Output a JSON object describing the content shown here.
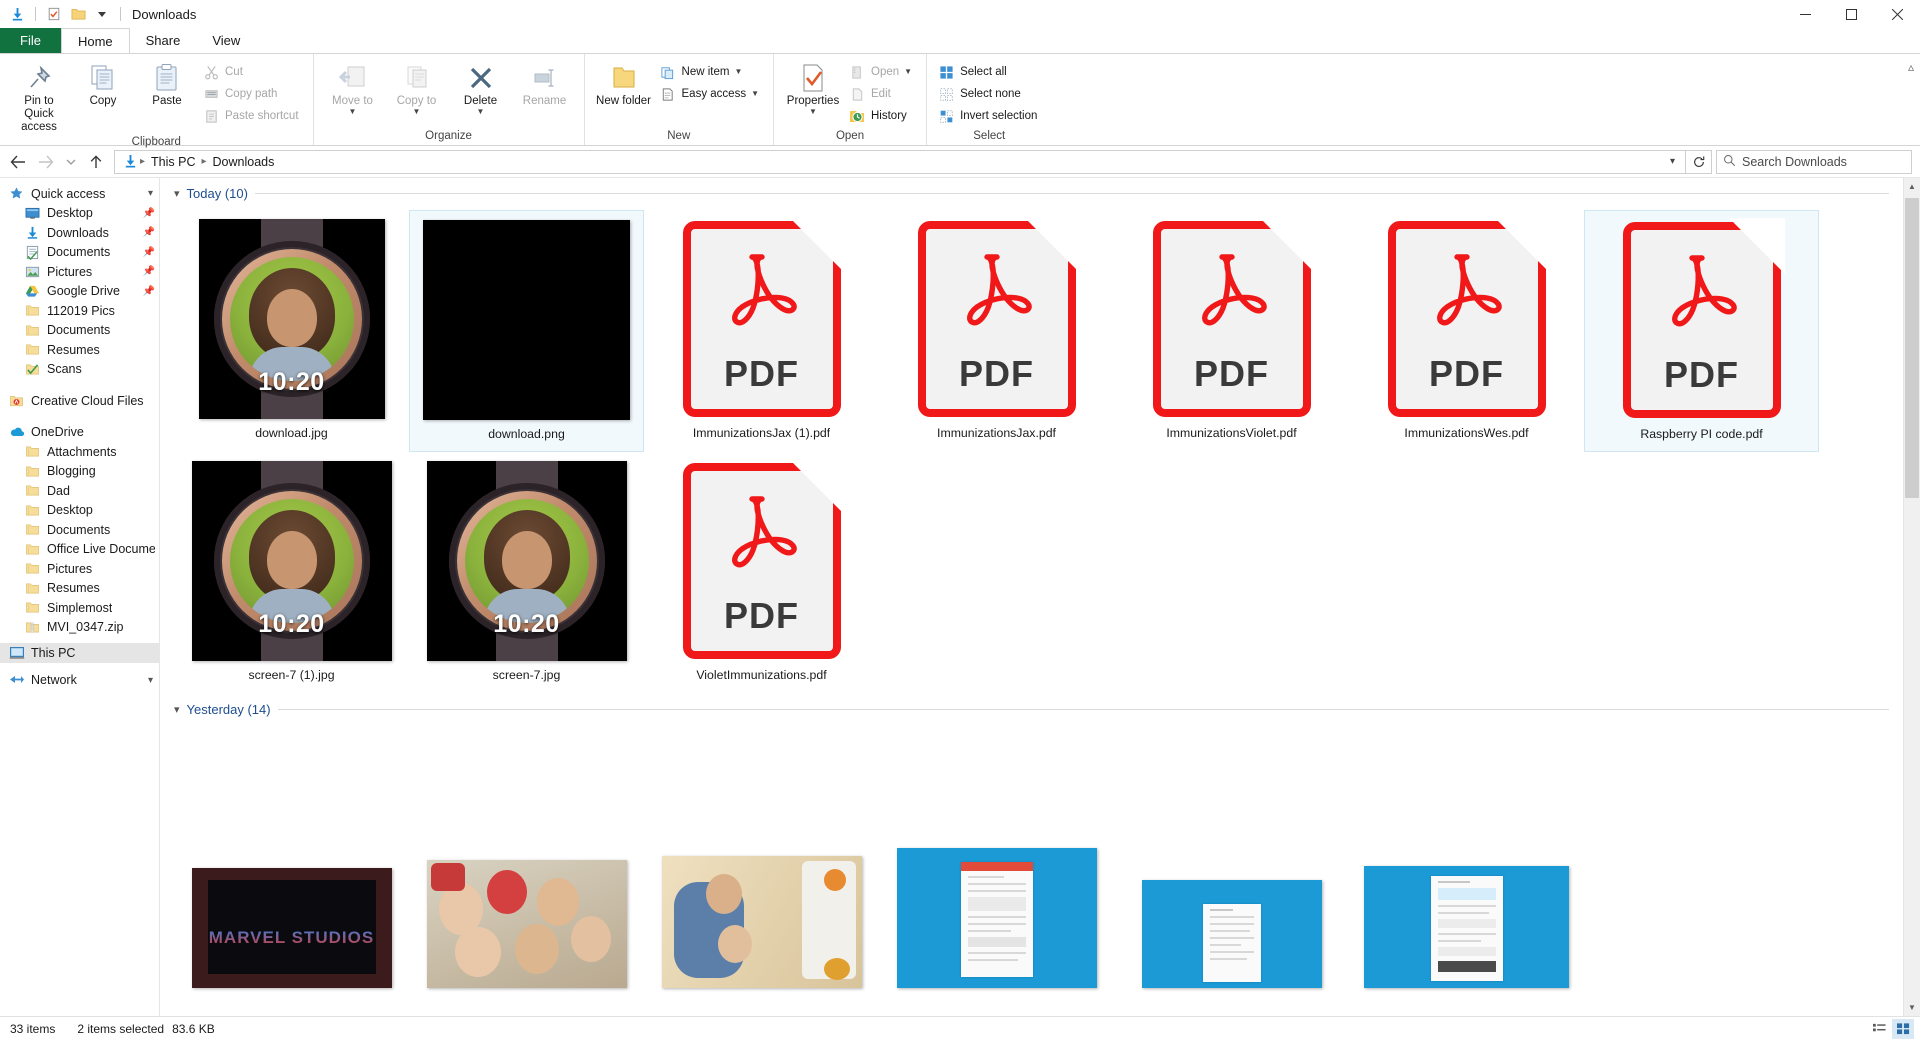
{
  "window": {
    "title": "Downloads",
    "quick_access_icons": [
      "download-icon",
      "checkbox-properties-icon",
      "folder-icon",
      "customize-chevron-icon"
    ],
    "controls": {
      "minimize": "─",
      "maximize": "☐",
      "close": "✕"
    }
  },
  "ribbon": {
    "tabs": [
      {
        "label": "File",
        "id": "file"
      },
      {
        "label": "Home",
        "id": "home"
      },
      {
        "label": "Share",
        "id": "share"
      },
      {
        "label": "View",
        "id": "view"
      }
    ],
    "active_tab": "Home",
    "help_icon": "help-question-icon",
    "collapse_icon": "collapse-ribbon-icon",
    "groups": [
      {
        "name": "Clipboard",
        "label": "Clipboard",
        "big_buttons": [
          {
            "label": "Pin to Quick access",
            "icon": "pin-icon",
            "disabled": false
          },
          {
            "label": "Copy",
            "icon": "copy-icon",
            "disabled": false
          },
          {
            "label": "Paste",
            "icon": "paste-icon",
            "disabled": false
          }
        ],
        "small_buttons": [
          {
            "label": "Cut",
            "icon": "scissors-icon",
            "disabled": true
          },
          {
            "label": "Copy path",
            "icon": "copy-path-icon",
            "disabled": true
          },
          {
            "label": "Paste shortcut",
            "icon": "paste-shortcut-icon",
            "disabled": true
          }
        ]
      },
      {
        "name": "Organize",
        "label": "Organize",
        "big_buttons": [
          {
            "label": "Move to",
            "icon": "move-to-icon",
            "disabled": true,
            "dropdown": true
          },
          {
            "label": "Copy to",
            "icon": "copy-to-icon",
            "disabled": true,
            "dropdown": true
          },
          {
            "label": "Delete",
            "icon": "delete-x-icon",
            "disabled": false,
            "dropdown": true
          },
          {
            "label": "Rename",
            "icon": "rename-icon",
            "disabled": true
          }
        ],
        "small_buttons": []
      },
      {
        "name": "New",
        "label": "New",
        "big_buttons": [
          {
            "label": "New folder",
            "icon": "new-folder-icon",
            "disabled": false
          }
        ],
        "small_buttons": [
          {
            "label": "New item",
            "icon": "new-item-icon",
            "disabled": false,
            "dropdown": true
          },
          {
            "label": "Easy access",
            "icon": "easy-access-icon",
            "disabled": false,
            "dropdown": true
          }
        ]
      },
      {
        "name": "Open",
        "label": "Open",
        "big_buttons": [
          {
            "label": "Properties",
            "icon": "properties-icon",
            "disabled": false,
            "dropdown": true
          }
        ],
        "small_buttons": [
          {
            "label": "Open",
            "icon": "open-icon",
            "disabled": true,
            "dropdown": true
          },
          {
            "label": "Edit",
            "icon": "edit-icon",
            "disabled": true
          },
          {
            "label": "History",
            "icon": "history-icon",
            "disabled": false
          }
        ]
      },
      {
        "name": "Select",
        "label": "Select",
        "big_buttons": [],
        "small_buttons": [
          {
            "label": "Select all",
            "icon": "select-all-icon",
            "disabled": false
          },
          {
            "label": "Select none",
            "icon": "select-none-icon",
            "disabled": false
          },
          {
            "label": "Invert selection",
            "icon": "invert-selection-icon",
            "disabled": false
          }
        ]
      }
    ]
  },
  "address": {
    "back_icon": "back-arrow-icon",
    "forward_icon": "forward-arrow-icon",
    "recent_icon": "recent-locations-chevron-icon",
    "up_icon": "up-arrow-icon",
    "path_icon": "downloads-folder-icon",
    "crumbs": [
      "This PC",
      "Downloads"
    ],
    "dropdown_icon": "address-dropdown-chevron",
    "refresh_icon": "refresh-icon",
    "search_icon": "search-icon",
    "search_placeholder": "Search Downloads",
    "search_value": ""
  },
  "sidebar": {
    "sections": [
      {
        "header": {
          "label": "Quick access",
          "icon": "star-pin-icon",
          "indent": 0,
          "chevron": true
        },
        "items": [
          {
            "label": "Desktop",
            "icon": "desktop-icon",
            "pinned": true,
            "indent": 1
          },
          {
            "label": "Downloads",
            "icon": "downloads-icon",
            "pinned": true,
            "indent": 1
          },
          {
            "label": "Documents",
            "icon": "documents-icon",
            "pinned": true,
            "indent": 1
          },
          {
            "label": "Pictures",
            "icon": "pictures-icon",
            "pinned": true,
            "indent": 1
          },
          {
            "label": "Google Drive",
            "icon": "google-drive-icon",
            "pinned": true,
            "indent": 1
          },
          {
            "label": "112019 Pics",
            "icon": "folder-icon",
            "pinned": false,
            "indent": 1
          },
          {
            "label": "Documents",
            "icon": "folder-icon",
            "pinned": false,
            "indent": 1
          },
          {
            "label": "Resumes",
            "icon": "folder-icon",
            "pinned": false,
            "indent": 1
          },
          {
            "label": "Scans",
            "icon": "scans-folder-icon",
            "pinned": false,
            "indent": 1
          }
        ]
      },
      {
        "header": {
          "label": "Creative Cloud Files",
          "icon": "creative-cloud-icon",
          "indent": 0,
          "chevron": false
        },
        "items": []
      },
      {
        "header": {
          "label": "OneDrive",
          "icon": "onedrive-cloud-icon",
          "indent": 0,
          "chevron": false
        },
        "items": [
          {
            "label": "Attachments",
            "icon": "folder-icon",
            "pinned": false,
            "indent": 1
          },
          {
            "label": "Blogging",
            "icon": "folder-icon",
            "pinned": false,
            "indent": 1
          },
          {
            "label": "Dad",
            "icon": "folder-icon",
            "pinned": false,
            "indent": 1
          },
          {
            "label": "Desktop",
            "icon": "folder-icon",
            "pinned": false,
            "indent": 1
          },
          {
            "label": "Documents",
            "icon": "folder-icon",
            "pinned": false,
            "indent": 1
          },
          {
            "label": "Office Live Docume",
            "icon": "folder-icon",
            "pinned": false,
            "indent": 1
          },
          {
            "label": "Pictures",
            "icon": "folder-icon",
            "pinned": false,
            "indent": 1
          },
          {
            "label": "Resumes",
            "icon": "folder-icon",
            "pinned": false,
            "indent": 1
          },
          {
            "label": "Simplemost",
            "icon": "folder-icon",
            "pinned": false,
            "indent": 1
          },
          {
            "label": "MVI_0347.zip",
            "icon": "zip-icon",
            "pinned": false,
            "indent": 1
          }
        ]
      },
      {
        "header": {
          "label": "This PC",
          "icon": "this-pc-icon",
          "indent": 0,
          "chevron": true,
          "selected": true
        },
        "items": []
      },
      {
        "header": {
          "label": "Network",
          "icon": "network-icon",
          "indent": 0,
          "chevron": false
        },
        "items": []
      }
    ]
  },
  "content": {
    "groups": [
      {
        "header": "Today (10)",
        "chevron": "∨",
        "files": [
          {
            "name": "download.jpg",
            "kind": "watch-photo",
            "selected": false
          },
          {
            "name": "download.png",
            "kind": "black-image",
            "selected": true
          },
          {
            "name": "ImmunizationsJax (1).pdf",
            "kind": "pdf",
            "selected": false
          },
          {
            "name": "ImmunizationsJax.pdf",
            "kind": "pdf",
            "selected": false
          },
          {
            "name": "ImmunizationsViolet.pdf",
            "kind": "pdf",
            "selected": false
          },
          {
            "name": "ImmunizationsWes.pdf",
            "kind": "pdf",
            "selected": false
          },
          {
            "name": "Raspberry PI code.pdf",
            "kind": "pdf",
            "selected": true
          },
          {
            "name": "screen-7 (1).jpg",
            "kind": "watch-photo",
            "selected": false
          },
          {
            "name": "screen-7.jpg",
            "kind": "watch-photo",
            "selected": false
          },
          {
            "name": "VioletImmunizations.pdf",
            "kind": "pdf",
            "selected": false
          }
        ]
      },
      {
        "header": "Yesterday (14)",
        "chevron": "∨",
        "files": [
          {
            "name": "",
            "kind": "marvel-photo",
            "selected": false
          },
          {
            "name": "",
            "kind": "xmas-photo",
            "selected": false
          },
          {
            "name": "",
            "kind": "kitchen-photo",
            "selected": false
          },
          {
            "name": "",
            "kind": "blue-screenshot-tall",
            "selected": false
          },
          {
            "name": "",
            "kind": "blue-screenshot-short",
            "selected": false
          },
          {
            "name": "",
            "kind": "blue-screenshot-wide",
            "selected": false
          }
        ]
      }
    ],
    "pdf_label": "PDF",
    "watch_time": "10:20"
  },
  "status": {
    "item_count": "33 items",
    "selection": "2 items selected",
    "size": "83.6 KB",
    "view_buttons": [
      {
        "icon": "details-view-icon",
        "active": false
      },
      {
        "icon": "large-icons-view-icon",
        "active": true
      }
    ]
  },
  "colors": {
    "file_tab_green": "#12723f",
    "pdf_red": "#f01818",
    "accent_blue": "#1b9ad6",
    "group_header_blue": "#1d4e8f",
    "selection_blue": "#cfe6f3"
  }
}
